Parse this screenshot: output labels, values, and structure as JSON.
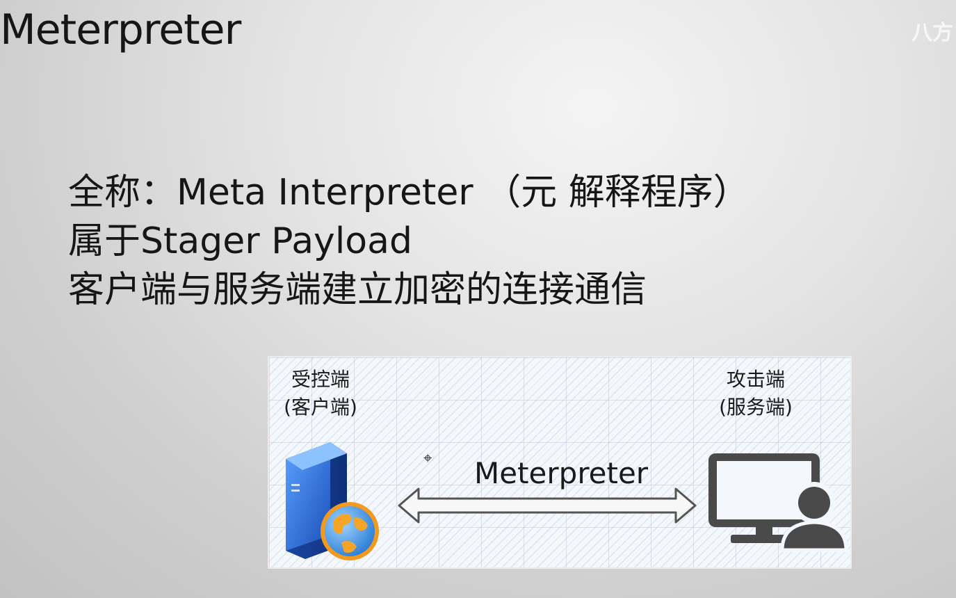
{
  "slide": {
    "title": "Meterpreter",
    "watermark": "八方",
    "bullets": [
      "全称：Meta Interpreter  （元 解释程序）",
      "属于Stager Payload",
      "客户端与服务端建立加密的连接通信"
    ]
  },
  "diagram": {
    "client_label_line1": "受控端",
    "client_label_line2": "(客户端)",
    "server_label_line1": "攻击端",
    "server_label_line2": "(服务端)",
    "connection_label": "Meterpreter",
    "client_icon": "server-globe-icon",
    "server_icon": "monitor-user-icon",
    "arrow_icon": "double-arrow-icon"
  },
  "colors": {
    "server_blue": "#2f6fd4",
    "globe_orange": "#f29a1f",
    "monitor_gray": "#4a4a4a"
  }
}
